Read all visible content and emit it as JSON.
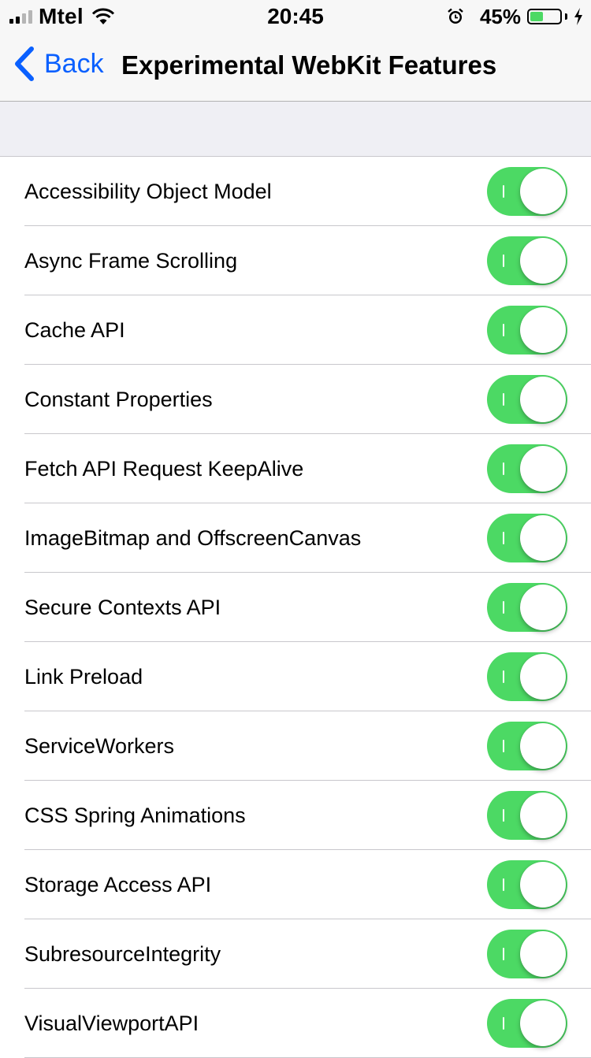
{
  "status_bar": {
    "carrier": "Mtel",
    "time": "20:45",
    "battery_percent_label": "45%",
    "battery_level": 0.45,
    "battery_color": "#4cd964",
    "icons": [
      "signal-icon",
      "wifi-icon",
      "alarm-icon",
      "battery-icon",
      "charging-bolt-icon"
    ]
  },
  "navbar": {
    "back_label": "Back",
    "title": "Experimental WebKit Features",
    "accent_color": "#0a60ff"
  },
  "features": [
    {
      "label": "Accessibility Object Model",
      "enabled": true
    },
    {
      "label": "Async Frame Scrolling",
      "enabled": true
    },
    {
      "label": "Cache API",
      "enabled": true
    },
    {
      "label": "Constant Properties",
      "enabled": true
    },
    {
      "label": "Fetch API Request KeepAlive",
      "enabled": true
    },
    {
      "label": "ImageBitmap and OffscreenCanvas",
      "enabled": true
    },
    {
      "label": "Secure Contexts API",
      "enabled": true
    },
    {
      "label": "Link Preload",
      "enabled": true
    },
    {
      "label": "ServiceWorkers",
      "enabled": true
    },
    {
      "label": "CSS Spring Animations",
      "enabled": true
    },
    {
      "label": "Storage Access API",
      "enabled": true
    },
    {
      "label": "SubresourceIntegrity",
      "enabled": true
    },
    {
      "label": "VisualViewportAPI",
      "enabled": true
    }
  ],
  "toggle_on_color": "#4cd964"
}
